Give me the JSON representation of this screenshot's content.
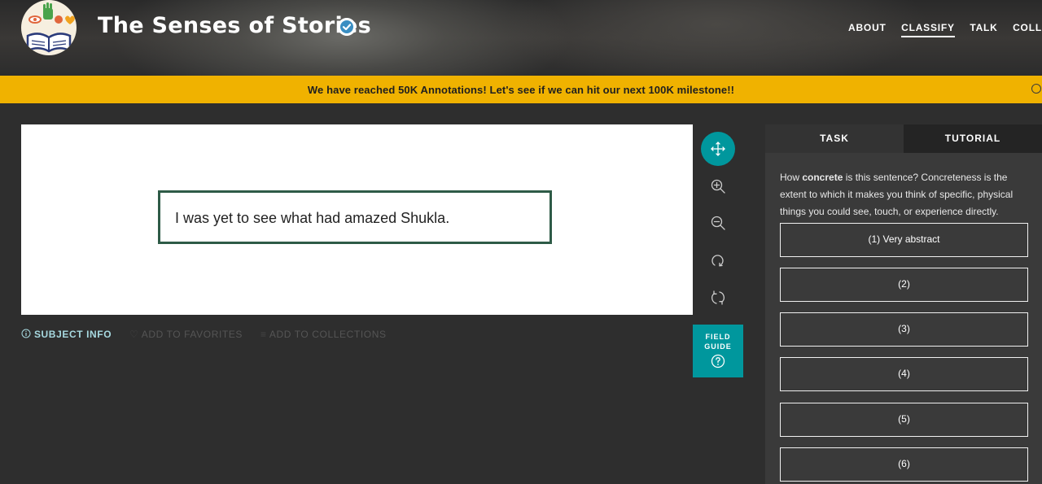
{
  "header": {
    "project_title": "The Senses of Stories",
    "nav": [
      {
        "label": "ABOUT",
        "active": false
      },
      {
        "label": "CLASSIFY",
        "active": true
      },
      {
        "label": "TALK",
        "active": false
      },
      {
        "label": "COLLECT",
        "active": false
      }
    ]
  },
  "banner": {
    "text": "We have reached 50K Annotations! Let's see if we can hit our next 100K milestone!!"
  },
  "subject": {
    "sentence": "I was yet to see what had amazed Shukla."
  },
  "toolbar": {
    "tools": [
      "move-icon",
      "zoom-in-icon",
      "zoom-out-icon",
      "rotate-icon",
      "reset-icon"
    ]
  },
  "meta": {
    "subject_info": "SUBJECT INFO",
    "add_to_favorites": "ADD TO FAVORITES",
    "add_to_collections": "ADD TO COLLECTIONS"
  },
  "field_guide": {
    "line1": "FIELD",
    "line2": "GUIDE"
  },
  "task": {
    "tab_task": "TASK",
    "tab_tutorial": "TUTORIAL",
    "question_prefix": "How ",
    "question_bold": "concrete",
    "question_rest": " is this sentence? Concreteness is the extent to which it makes you think of specific, physical things you could see, touch, or experience directly.",
    "answers": [
      "(1) Very abstract",
      "(2)",
      "(3)",
      "(4)",
      "(5)",
      "(6)"
    ]
  },
  "colors": {
    "accent": "#00979d",
    "banner": "#f0b200",
    "sentence_border": "#2e5b47"
  }
}
